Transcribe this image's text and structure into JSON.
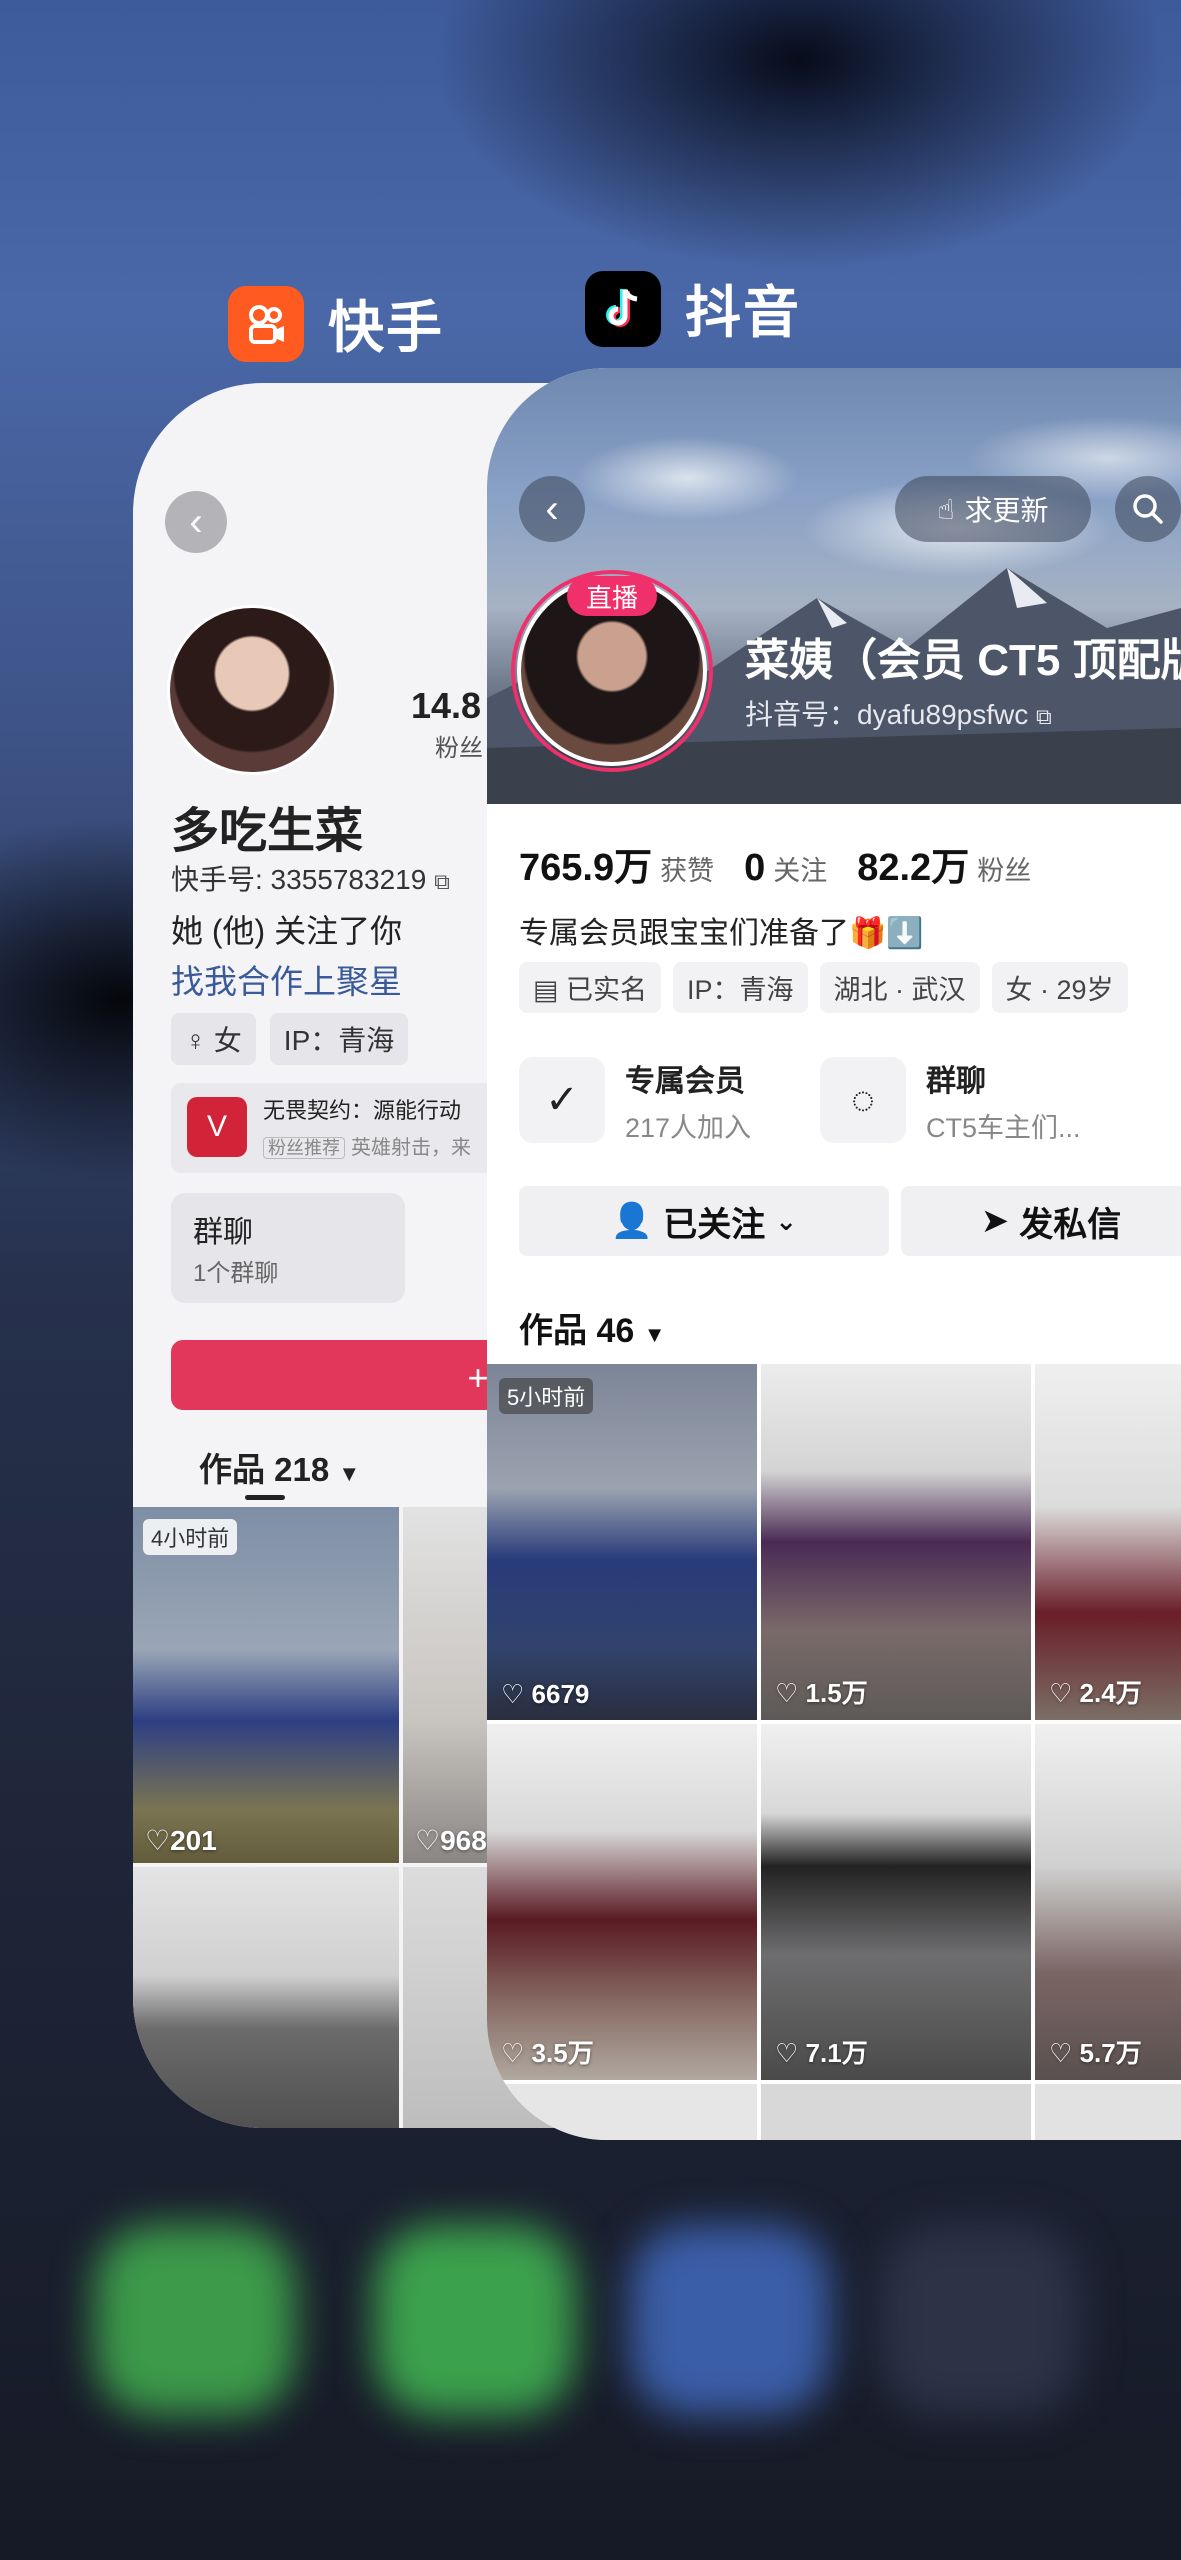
{
  "apps": {
    "kuaishou": {
      "name": "快手",
      "color": "#ff5a1f"
    },
    "douyin": {
      "name": "抖音",
      "color": "#000000"
    }
  },
  "kuaishou_profile": {
    "fans_count": "14.8",
    "fans_label": "粉丝",
    "name": "多吃生菜",
    "id_text": "快手号: 3355783219",
    "follows_you": "她 (他) 关注了你",
    "link_text": "找我合作上聚星",
    "tags": [
      "女",
      "IP：青海"
    ],
    "promo": {
      "title": "无畏契约：源能行动",
      "badge": "粉丝推荐",
      "sub": "英雄射击，来"
    },
    "group": {
      "title": "群聊",
      "sub": "1个群聊"
    },
    "follow_button": "+ 关",
    "works_label": "作品 218",
    "thumbs": [
      {
        "badge": "4小时前",
        "likes": "201"
      },
      {
        "badge": "",
        "likes": "968"
      },
      {
        "badge": "",
        "likes": ""
      },
      {
        "badge": "",
        "likes": ""
      }
    ]
  },
  "douyin_profile": {
    "live_badge": "直播",
    "update_button": "求更新",
    "name": "菜姨（会员 CT5 顶配版",
    "id_text": "抖音号：dyafu89psfwc",
    "stats": [
      {
        "value": "765.9万",
        "label": "获赞"
      },
      {
        "value": "0",
        "label": "关注"
      },
      {
        "value": "82.2万",
        "label": "粉丝"
      }
    ],
    "bio": "专属会员跟宝宝们准备了🎁⬇️",
    "tags": [
      "已实名",
      "IP：青海",
      "湖北 · 武汉",
      "女 · 29岁"
    ],
    "member_feature": {
      "title": "专属会员",
      "sub": "217人加入"
    },
    "group_feature": {
      "title": "群聊",
      "sub": "CT5车主们..."
    },
    "following_button": "已关注",
    "message_button": "发私信",
    "works_label": "作品 46",
    "thumbs": [
      {
        "time": "5小时前",
        "likes": "6679"
      },
      {
        "time": "",
        "likes": "1.5万"
      },
      {
        "time": "",
        "likes": "2.4万"
      },
      {
        "time": "",
        "likes": "3.5万"
      },
      {
        "time": "",
        "likes": "7.1万"
      },
      {
        "time": "",
        "likes": "5.7万"
      }
    ]
  }
}
